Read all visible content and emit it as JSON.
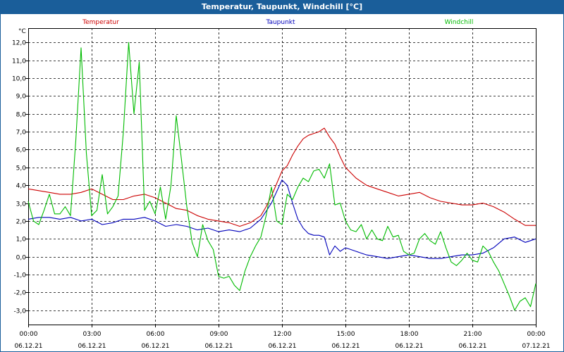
{
  "window": {
    "title": "Temperatur, Taupunkt, Windchill [°C]"
  },
  "chart_data": {
    "type": "line",
    "title": "Temperatur, Taupunkt, Windchill [°C]",
    "ylabel": "°C",
    "xlabel": "",
    "ylim": [
      -3.8,
      12.8
    ],
    "y_ticks": [
      -3.0,
      -2.0,
      -1.0,
      0.0,
      1.0,
      2.0,
      3.0,
      4.0,
      5.0,
      6.0,
      7.0,
      8.0,
      9.0,
      10.0,
      11.0,
      12.0
    ],
    "y_tick_labels": [
      "-3,0",
      "-2,0",
      "-1,0",
      "0,0",
      "1,0",
      "2,0",
      "3,0",
      "4,0",
      "5,0",
      "6,0",
      "7,0",
      "8,0",
      "9,0",
      "10,0",
      "11,0",
      "12,0"
    ],
    "xlim": [
      0,
      24
    ],
    "x_ticks": [
      0,
      3,
      6,
      9,
      12,
      15,
      18,
      21,
      24
    ],
    "x_tick_times": [
      "00:00",
      "03:00",
      "06:00",
      "09:00",
      "12:00",
      "15:00",
      "18:00",
      "21:00",
      "00:00"
    ],
    "x_tick_dates": [
      "06.12.21",
      "06.12.21",
      "06.12.21",
      "06.12.21",
      "06.12.21",
      "06.12.21",
      "06.12.21",
      "06.12.21",
      "07.12.21"
    ],
    "grid": true,
    "legend_position": "top",
    "series": [
      {
        "name": "Temperatur",
        "color": "#cc0000",
        "x": [
          0,
          0.5,
          1,
          1.5,
          2,
          2.5,
          3,
          3.5,
          4,
          4.5,
          5,
          5.5,
          6,
          6.5,
          7,
          7.5,
          8,
          8.5,
          9,
          9.5,
          10,
          10.5,
          11,
          11.25,
          11.5,
          11.75,
          12,
          12.25,
          12.5,
          12.75,
          13,
          13.25,
          13.5,
          13.75,
          14,
          14.25,
          14.5,
          14.75,
          15,
          15.5,
          16,
          16.5,
          17,
          17.5,
          18,
          18.5,
          19,
          19.5,
          20,
          20.5,
          21,
          21.5,
          22,
          22.5,
          23,
          23.5,
          24
        ],
        "values": [
          3.8,
          3.7,
          3.6,
          3.5,
          3.5,
          3.6,
          3.8,
          3.5,
          3.2,
          3.2,
          3.4,
          3.5,
          3.3,
          3.0,
          2.7,
          2.6,
          2.3,
          2.1,
          2.0,
          1.9,
          1.7,
          1.9,
          2.3,
          2.8,
          3.4,
          4.1,
          4.8,
          5.1,
          5.7,
          6.2,
          6.6,
          6.8,
          6.9,
          7.0,
          7.2,
          6.7,
          6.3,
          5.6,
          5.0,
          4.4,
          4.0,
          3.8,
          3.6,
          3.4,
          3.5,
          3.6,
          3.3,
          3.1,
          3.0,
          2.9,
          2.9,
          3.0,
          2.8,
          2.5,
          2.1,
          1.75,
          1.75
        ]
      },
      {
        "name": "Taupunkt",
        "color": "#0000bb",
        "x": [
          0,
          0.5,
          1,
          1.5,
          2,
          2.5,
          3,
          3.5,
          4,
          4.5,
          5,
          5.5,
          6,
          6.5,
          7,
          7.5,
          8,
          8.5,
          9,
          9.5,
          10,
          10.5,
          11,
          11.5,
          12,
          12.25,
          12.5,
          12.75,
          13,
          13.25,
          13.5,
          13.75,
          14,
          14.25,
          14.5,
          14.75,
          15,
          15.5,
          16,
          16.5,
          17,
          17.5,
          18,
          18.5,
          19,
          19.5,
          20,
          20.5,
          21,
          21.5,
          22,
          22.5,
          23,
          23.5,
          24
        ],
        "values": [
          2.1,
          2.2,
          2.2,
          2.1,
          2.2,
          2.0,
          2.1,
          1.8,
          1.9,
          2.1,
          2.1,
          2.2,
          2.0,
          1.7,
          1.8,
          1.7,
          1.5,
          1.6,
          1.4,
          1.5,
          1.4,
          1.6,
          2.1,
          3.0,
          4.3,
          4.0,
          3.0,
          2.1,
          1.6,
          1.3,
          1.2,
          1.2,
          1.1,
          0.1,
          0.6,
          0.3,
          0.5,
          0.3,
          0.1,
          0.0,
          -0.1,
          0.0,
          0.1,
          0.0,
          -0.1,
          -0.1,
          0.0,
          0.1,
          0.1,
          0.2,
          0.5,
          1.0,
          1.1,
          0.8,
          1.0
        ]
      },
      {
        "name": "Windchill",
        "color": "#00bb00",
        "x": [
          0,
          0.25,
          0.5,
          0.75,
          1,
          1.25,
          1.5,
          1.75,
          2,
          2.25,
          2.5,
          2.75,
          3,
          3.25,
          3.5,
          3.75,
          4,
          4.25,
          4.5,
          4.75,
          5,
          5.25,
          5.5,
          5.75,
          6,
          6.25,
          6.5,
          6.75,
          7,
          7.25,
          7.5,
          7.75,
          8,
          8.25,
          8.5,
          8.75,
          9,
          9.25,
          9.5,
          9.75,
          10,
          10.25,
          10.5,
          10.75,
          11,
          11.25,
          11.5,
          11.75,
          12,
          12.25,
          12.5,
          12.75,
          13,
          13.25,
          13.5,
          13.75,
          14,
          14.25,
          14.5,
          14.75,
          15,
          15.25,
          15.5,
          15.75,
          16,
          16.25,
          16.5,
          16.75,
          17,
          17.25,
          17.5,
          17.75,
          18,
          18.25,
          18.5,
          18.75,
          19,
          19.25,
          19.5,
          19.75,
          20,
          20.25,
          20.5,
          20.75,
          21,
          21.25,
          21.5,
          21.75,
          22,
          22.25,
          22.5,
          22.75,
          23,
          23.25,
          23.5,
          23.75,
          24
        ],
        "values": [
          3.1,
          2.0,
          1.8,
          2.6,
          3.5,
          2.4,
          2.4,
          2.8,
          2.3,
          6.5,
          11.7,
          5.8,
          2.3,
          2.6,
          4.6,
          2.4,
          2.8,
          3.4,
          7.0,
          12.0,
          8.0,
          10.9,
          2.6,
          3.1,
          2.4,
          3.9,
          2.1,
          4.0,
          7.9,
          5.4,
          2.8,
          0.8,
          0.0,
          1.8,
          0.9,
          0.4,
          -1.1,
          -1.2,
          -1.1,
          -1.6,
          -1.9,
          -0.8,
          0.0,
          0.6,
          1.1,
          2.3,
          3.9,
          2.0,
          1.8,
          3.5,
          3.2,
          3.9,
          4.4,
          4.2,
          4.8,
          4.9,
          4.4,
          5.2,
          2.9,
          3.0,
          2.0,
          1.5,
          1.4,
          1.8,
          1.0,
          1.5,
          1.0,
          0.9,
          1.7,
          1.1,
          1.2,
          0.3,
          0.1,
          0.2,
          1.0,
          1.3,
          0.9,
          0.7,
          1.4,
          0.5,
          -0.3,
          -0.5,
          -0.2,
          0.2,
          -0.2,
          -0.3,
          0.6,
          0.3,
          -0.3,
          -0.8,
          -1.5,
          -2.2,
          -3.0,
          -2.5,
          -2.3,
          -2.8,
          -1.5
        ]
      }
    ]
  }
}
